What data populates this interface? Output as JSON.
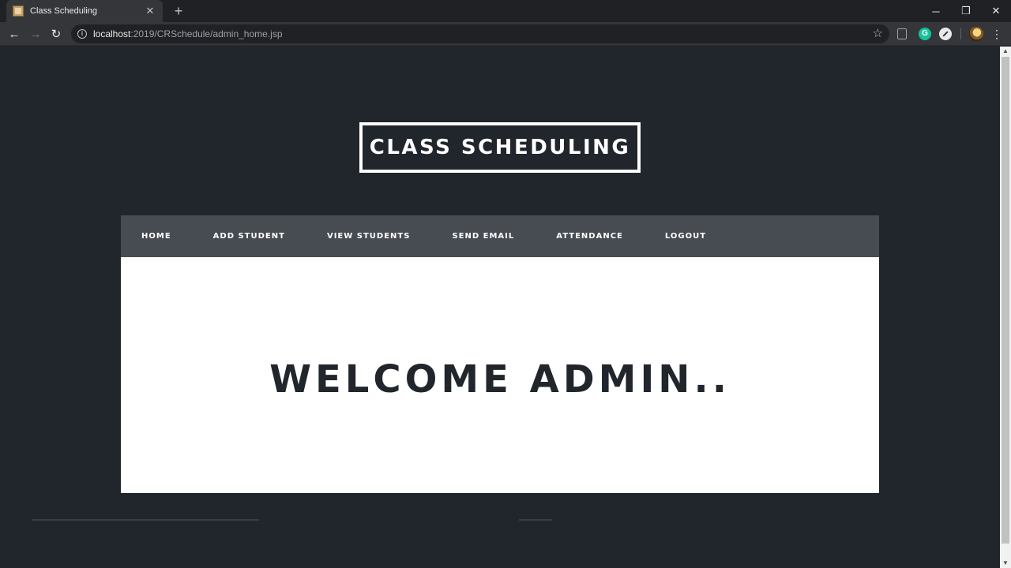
{
  "browser": {
    "tab": {
      "title": "Class Scheduling",
      "close_glyph": "✕"
    },
    "new_tab_glyph": "+",
    "window": {
      "minimize": "─",
      "maximize": "❐",
      "close": "✕"
    },
    "toolbar": {
      "back_glyph": "←",
      "forward_glyph": "→",
      "reload_glyph": "↻",
      "info_glyph": "i",
      "url_host": "localhost",
      "url_path": ":2019/CRSchedule/admin_home.jsp",
      "star_glyph": "☆",
      "grammarly_glyph": "G",
      "menu_glyph": "⋮"
    }
  },
  "page": {
    "brand": "CLASS SCHEDULING",
    "nav": [
      "HOME",
      "ADD STUDENT",
      "VIEW STUDENTS",
      "SEND EMAIL",
      "ATTENDANCE",
      "LOGOUT"
    ],
    "welcome": "WELCOME ADMIN.."
  },
  "scrollbar": {
    "up_glyph": "▲",
    "down_glyph": "▼"
  },
  "colors": {
    "page_bg": "#21252c",
    "navbar_bg": "#474b52",
    "content_bg": "#ffffff",
    "welcome_text": "#21252c"
  }
}
